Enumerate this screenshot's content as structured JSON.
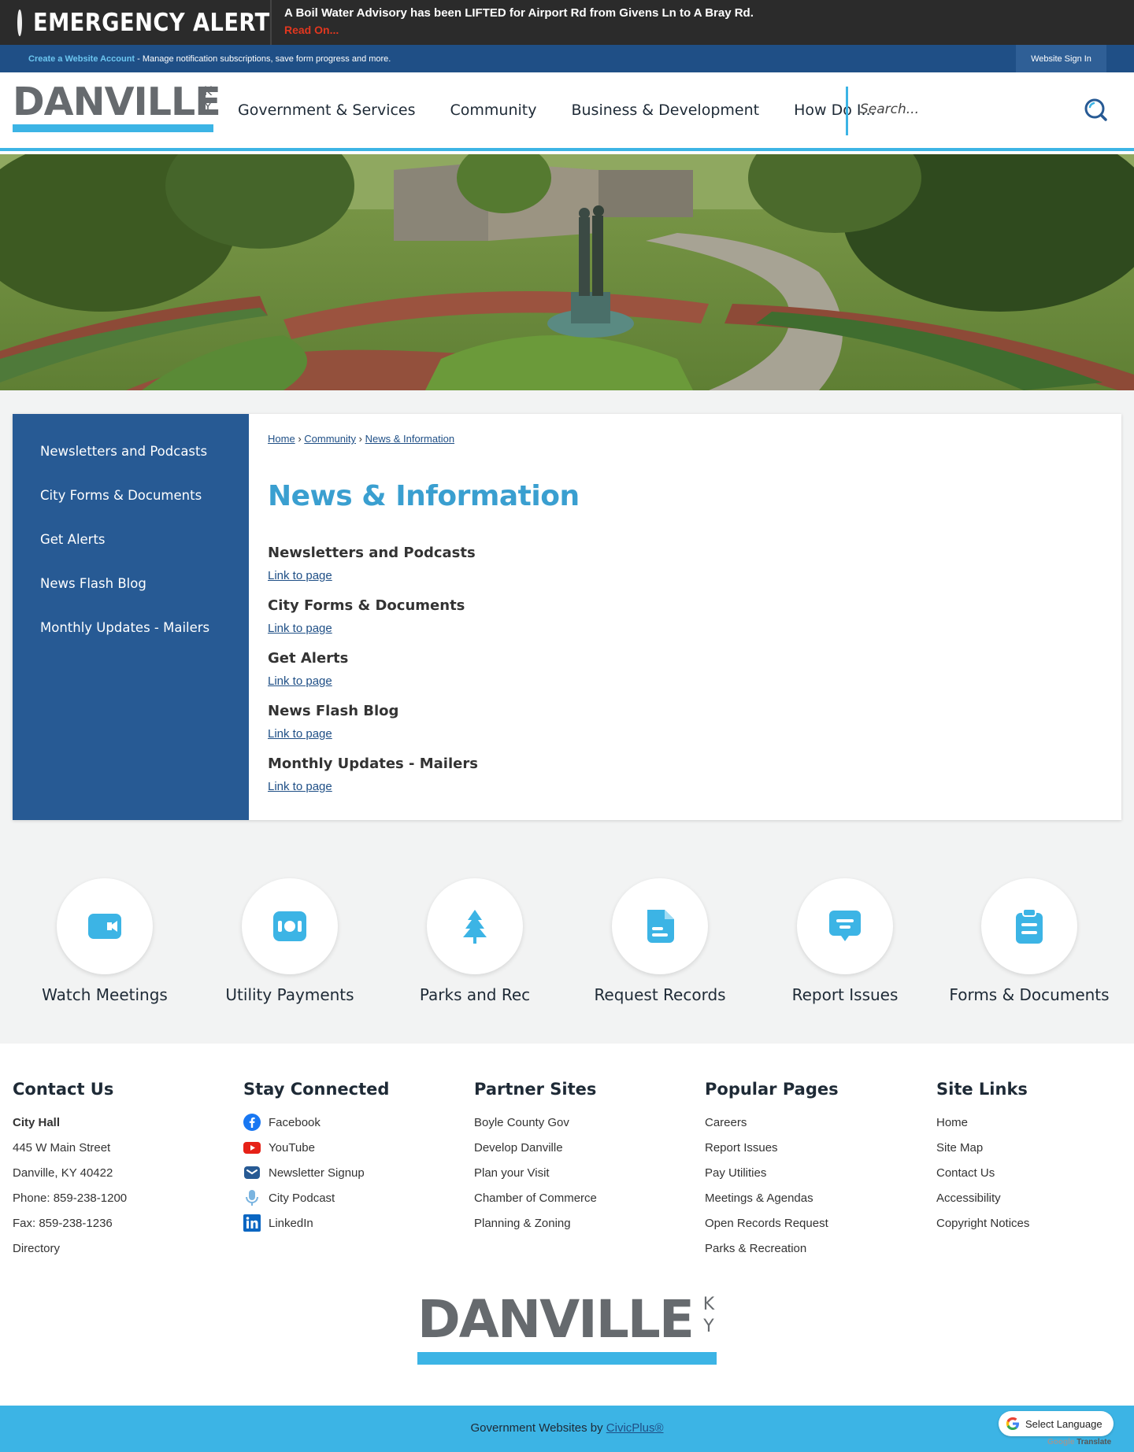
{
  "alert": {
    "title": "EMERGENCY ALERT",
    "message": "A Boil Water Advisory has been LIFTED for Airport Rd from Givens Ln to A Bray Rd.",
    "link": "Read On..."
  },
  "account_bar": {
    "create_link": "Create a Website Account",
    "description": " - Manage notification subscriptions, save form progress and more.",
    "sign_in": "Website Sign In"
  },
  "logo": {
    "word": "DANVILLE",
    "state_k": "K",
    "state_y": "Y"
  },
  "nav": {
    "items": [
      "Government & Services",
      "Community",
      "Business & Development",
      "How Do I..."
    ],
    "search_placeholder": "Search..."
  },
  "sidebar": {
    "items": [
      "Newsletters and Podcasts",
      "City Forms & Documents",
      "Get Alerts",
      "News Flash Blog",
      "Monthly Updates - Mailers"
    ]
  },
  "breadcrumb": {
    "home": "Home",
    "community": "Community",
    "current": "News & Information",
    "sep": "›"
  },
  "page_title": "News & Information",
  "entries": [
    {
      "title": "Newsletters and Podcasts",
      "link": "Link to page"
    },
    {
      "title": "City Forms & Documents",
      "link": "Link to page"
    },
    {
      "title": "Get Alerts",
      "link": "Link to page"
    },
    {
      "title": "News Flash Blog",
      "link": "Link to page"
    },
    {
      "title": "Monthly Updates - Mailers",
      "link": "Link to page"
    }
  ],
  "quick_links": [
    {
      "label": "Watch Meetings",
      "icon": "video-camera-icon"
    },
    {
      "label": "Utility Payments",
      "icon": "money-bill-icon"
    },
    {
      "label": "Parks and Rec",
      "icon": "tree-icon"
    },
    {
      "label": "Request Records",
      "icon": "document-icon"
    },
    {
      "label": "Report Issues",
      "icon": "message-icon"
    },
    {
      "label": "Forms & Documents",
      "icon": "clipboard-icon"
    }
  ],
  "footer": {
    "contact": {
      "heading": "Contact Us",
      "name": "City Hall",
      "address1": "445 W Main Street",
      "address2": "Danville, KY 40422",
      "phone": "Phone: 859-238-1200",
      "fax": "Fax: 859-238-1236",
      "directory": "Directory"
    },
    "stay_connected": {
      "heading": "Stay Connected",
      "items": [
        "Facebook",
        "YouTube",
        "Newsletter Signup",
        "City Podcast",
        "LinkedIn"
      ]
    },
    "partner_sites": {
      "heading": "Partner Sites",
      "items": [
        "Boyle County Gov",
        "Develop Danville",
        "Plan your Visit",
        "Chamber of Commerce",
        "Planning & Zoning"
      ]
    },
    "popular_pages": {
      "heading": "Popular Pages",
      "items": [
        "Careers",
        "Report Issues",
        "Pay Utilities",
        "Meetings & Agendas",
        "Open Records Request",
        "Parks & Recreation"
      ]
    },
    "site_links": {
      "heading": "Site Links",
      "items": [
        "Home",
        "Site Map",
        "Contact Us",
        "Accessibility",
        "Copyright Notices"
      ]
    }
  },
  "bottom": {
    "text": "Government Websites by ",
    "link": "CivicPlus®",
    "language": "Select Language",
    "credit_google": "Google",
    "credit_translate": "Translate"
  },
  "colors": {
    "accent_blue": "#3cb4e5",
    "navy": "#275a94",
    "account_bar": "#1f4f86",
    "title_blue": "#3a9fd0",
    "alert_red": "#e2371f"
  }
}
